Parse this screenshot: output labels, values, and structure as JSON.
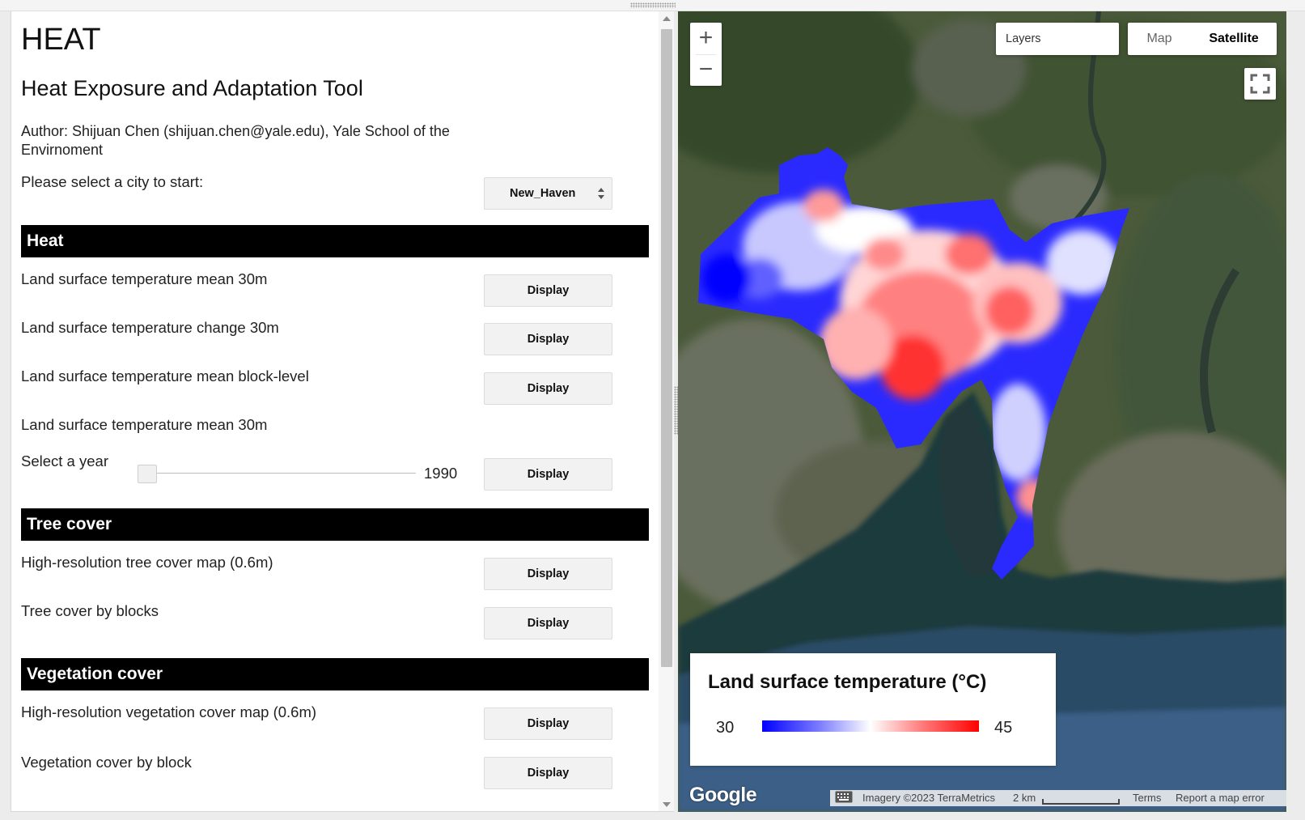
{
  "panel": {
    "title": "HEAT",
    "subtitle": "Heat Exposure and Adaptation Tool",
    "author": "Author: Shijuan Chen (shijuan.chen@yale.edu), Yale School of the Envirnoment",
    "city_prompt": "Please select a city to start:",
    "city_selected": "New_Haven",
    "sections": {
      "heat": "Heat",
      "tree": "Tree cover",
      "veg": "Vegetation cover"
    },
    "items": {
      "lst_mean_30m": "Land surface temperature mean 30m",
      "lst_change_30m": "Land surface temperature change 30m",
      "lst_mean_block": "Land surface temperature mean block-level",
      "lst_mean_30m_year": "Land surface temperature mean 30m",
      "tree_hr": "High-resolution tree cover map (0.6m)",
      "tree_blocks": "Tree cover by blocks",
      "veg_hr": "High-resolution vegetation cover map (0.6m)",
      "veg_block": "Vegetation cover by block"
    },
    "year_label": "Select a year",
    "year_value": "1990",
    "display_label": "Display"
  },
  "map": {
    "zoom_in": "+",
    "zoom_out": "−",
    "layers_label": "Layers",
    "maptype_map": "Map",
    "maptype_satellite": "Satellite",
    "legend": {
      "title": "Land surface temperature (°C)",
      "min": "30",
      "max": "45",
      "color_low": "#0000ff",
      "color_mid": "#ffffff",
      "color_high": "#ff0000"
    },
    "google_logo": "Google",
    "attribution": "Imagery ©2023 TerraMetrics",
    "scale": "2 km",
    "terms": "Terms",
    "report": "Report a map error"
  }
}
